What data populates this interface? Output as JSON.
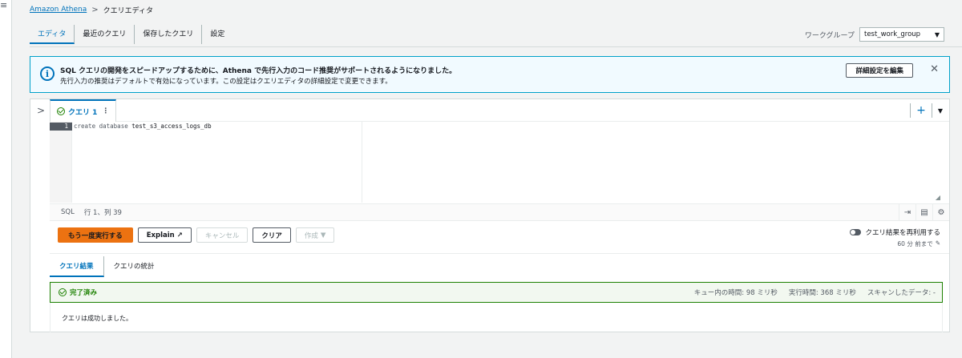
{
  "breadcrumb": {
    "root": "Amazon Athena",
    "current": "クエリエディタ"
  },
  "tabs": [
    "エディタ",
    "最近のクエリ",
    "保存したクエリ",
    "設定"
  ],
  "workgroup": {
    "label": "ワークグループ",
    "value": "test_work_group"
  },
  "info": {
    "title": "SQL クエリの開発をスピードアップするために、Athena で先行入力のコード推奨がサポートされるようになりました。",
    "sub": "先行入力の推奨はデフォルトで有効になっています。この設定はクエリエディタの詳細設定で変更できます。",
    "button": "詳細設定を編集"
  },
  "query_tab": {
    "label": "クエリ 1"
  },
  "editor": {
    "line_number": "1",
    "keyword": "create database",
    "identifier": "test_s3_access_logs_db",
    "language": "SQL",
    "position": "行 1、列 39"
  },
  "actions": {
    "run": "もう一度実行する",
    "explain": "Explain",
    "cancel": "キャンセル",
    "clear": "クリア",
    "create": "作成"
  },
  "reuse": {
    "label": "クエリ結果を再利用する",
    "sub": "60 分 前まで"
  },
  "result_tabs": [
    "クエリ結果",
    "クエリの統計"
  ],
  "result": {
    "status": "完了済み",
    "queue_time": "キュー内の時間: 98 ミリ秒",
    "run_time": "実行時間: 368 ミリ秒",
    "scanned": "スキャンしたデータ: -",
    "message": "クエリは成功しました。"
  },
  "colors": {
    "accent": "#0073bb",
    "primary": "#ec7211",
    "success": "#1d8102"
  }
}
